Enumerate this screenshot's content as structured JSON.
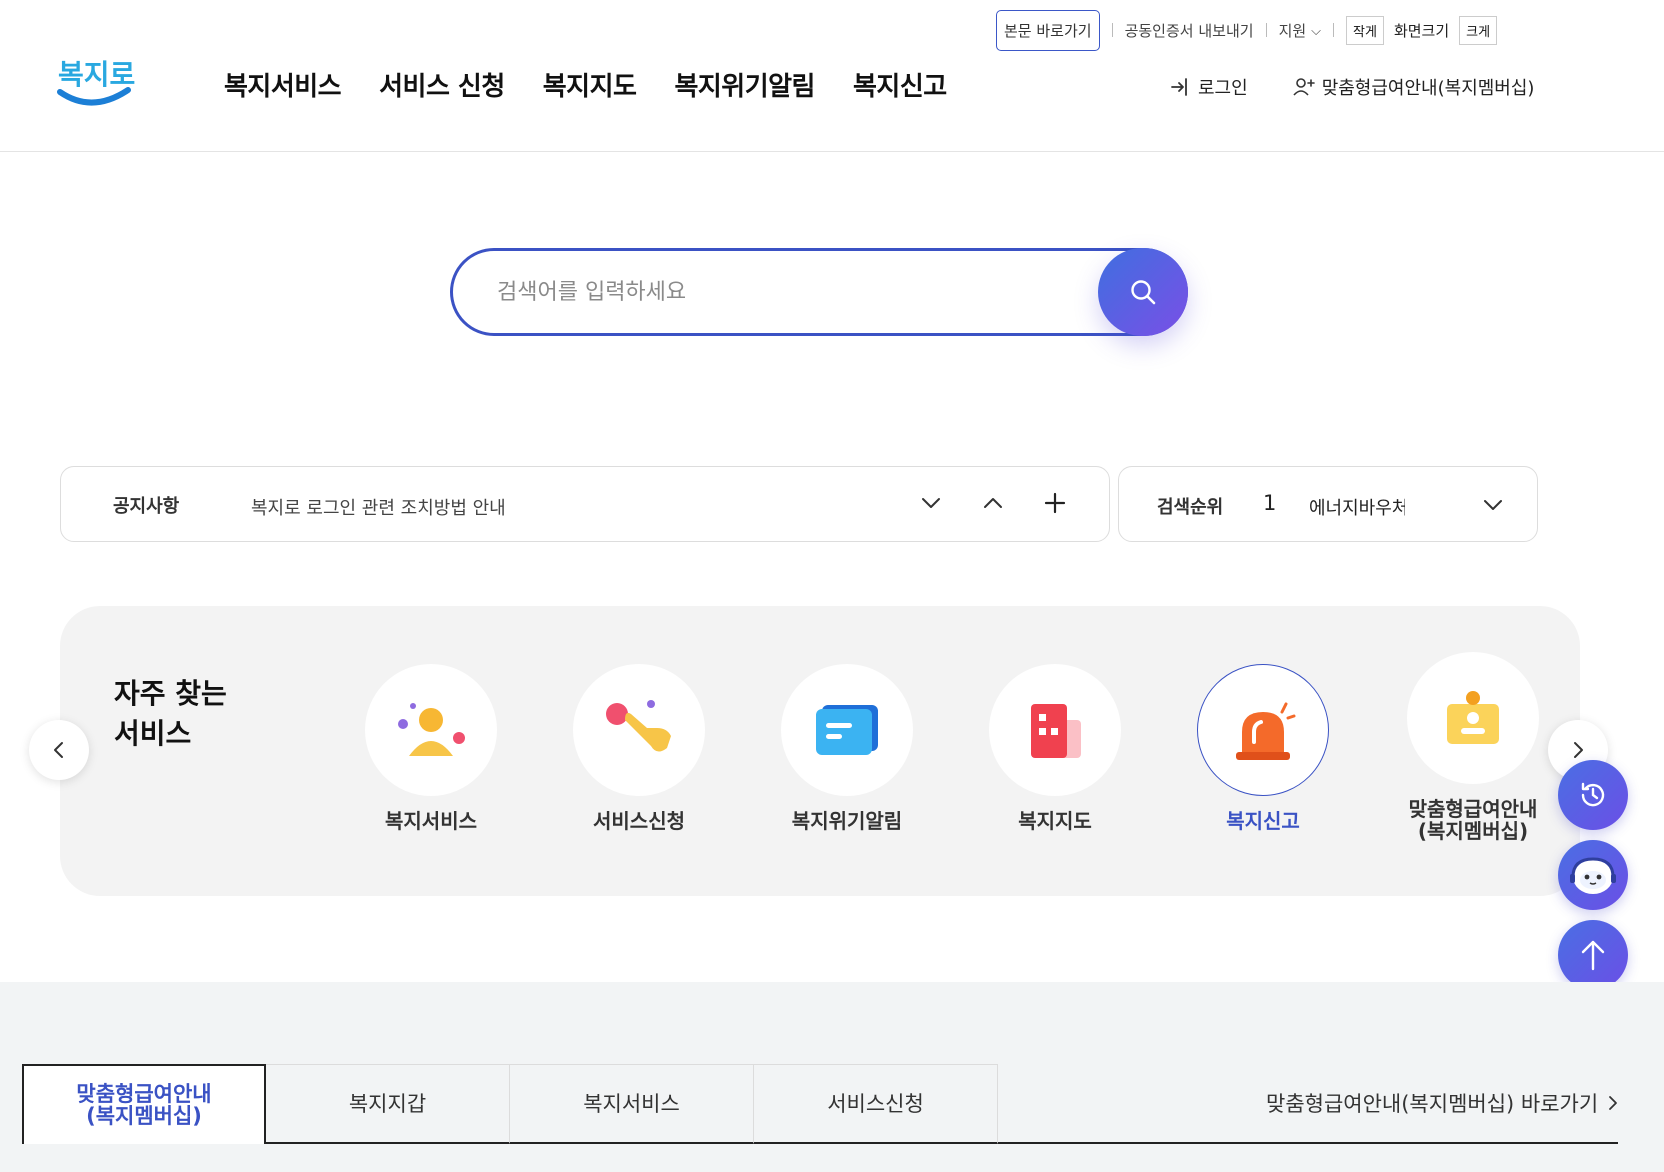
{
  "util": {
    "skip_label": "본문 바로가기",
    "cert_label": "공동인증서 내보내기",
    "support_label": "지원",
    "size_small": "작게",
    "size_label": "화면크기",
    "size_large": "크게"
  },
  "logo": {
    "text": "복지로"
  },
  "nav": [
    "복지서비스",
    "서비스 신청",
    "복지지도",
    "복지위기알림",
    "복지신고"
  ],
  "member": {
    "login": "로그인",
    "membership": "맞춤형급여안내(복지멤버십)"
  },
  "search": {
    "placeholder": "검색어를 입력하세요"
  },
  "notice": {
    "label": "공지사항",
    "text": "복지로 로그인 관련 조치방법 안내"
  },
  "rank": {
    "label": "검색순위",
    "number": "1",
    "term": "에너지바우처"
  },
  "frequent": {
    "title_line1": "자주 찾는",
    "title_line2": "서비스",
    "items": [
      {
        "label": "복지서비스",
        "icon": "person-icon"
      },
      {
        "label": "서비스신청",
        "icon": "hand-tap-icon"
      },
      {
        "label": "복지위기알림",
        "icon": "message-icon"
      },
      {
        "label": "복지지도",
        "icon": "building-icon"
      },
      {
        "label": "복지신고",
        "icon": "siren-icon"
      },
      {
        "label_line1": "맞춤형급여안내",
        "label_line2": "(복지멤버십)",
        "icon": "id-card-icon"
      }
    ]
  },
  "bottom_tabs": {
    "tabs": [
      {
        "label_line1": "맞춤형급여안내",
        "label_line2": "(복지멤버십)"
      },
      {
        "label": "복지지갑"
      },
      {
        "label": "복지서비스"
      },
      {
        "label": "서비스신청"
      }
    ],
    "shortcut": "맞춤형급여안내(복지멤버십) 바로가기"
  },
  "colors": {
    "brand_blue": "#3a52c4",
    "accent_gradient_start": "#3f6fe0",
    "accent_gradient_end": "#7a4fe6",
    "panel_bg": "#f3f3f3"
  }
}
